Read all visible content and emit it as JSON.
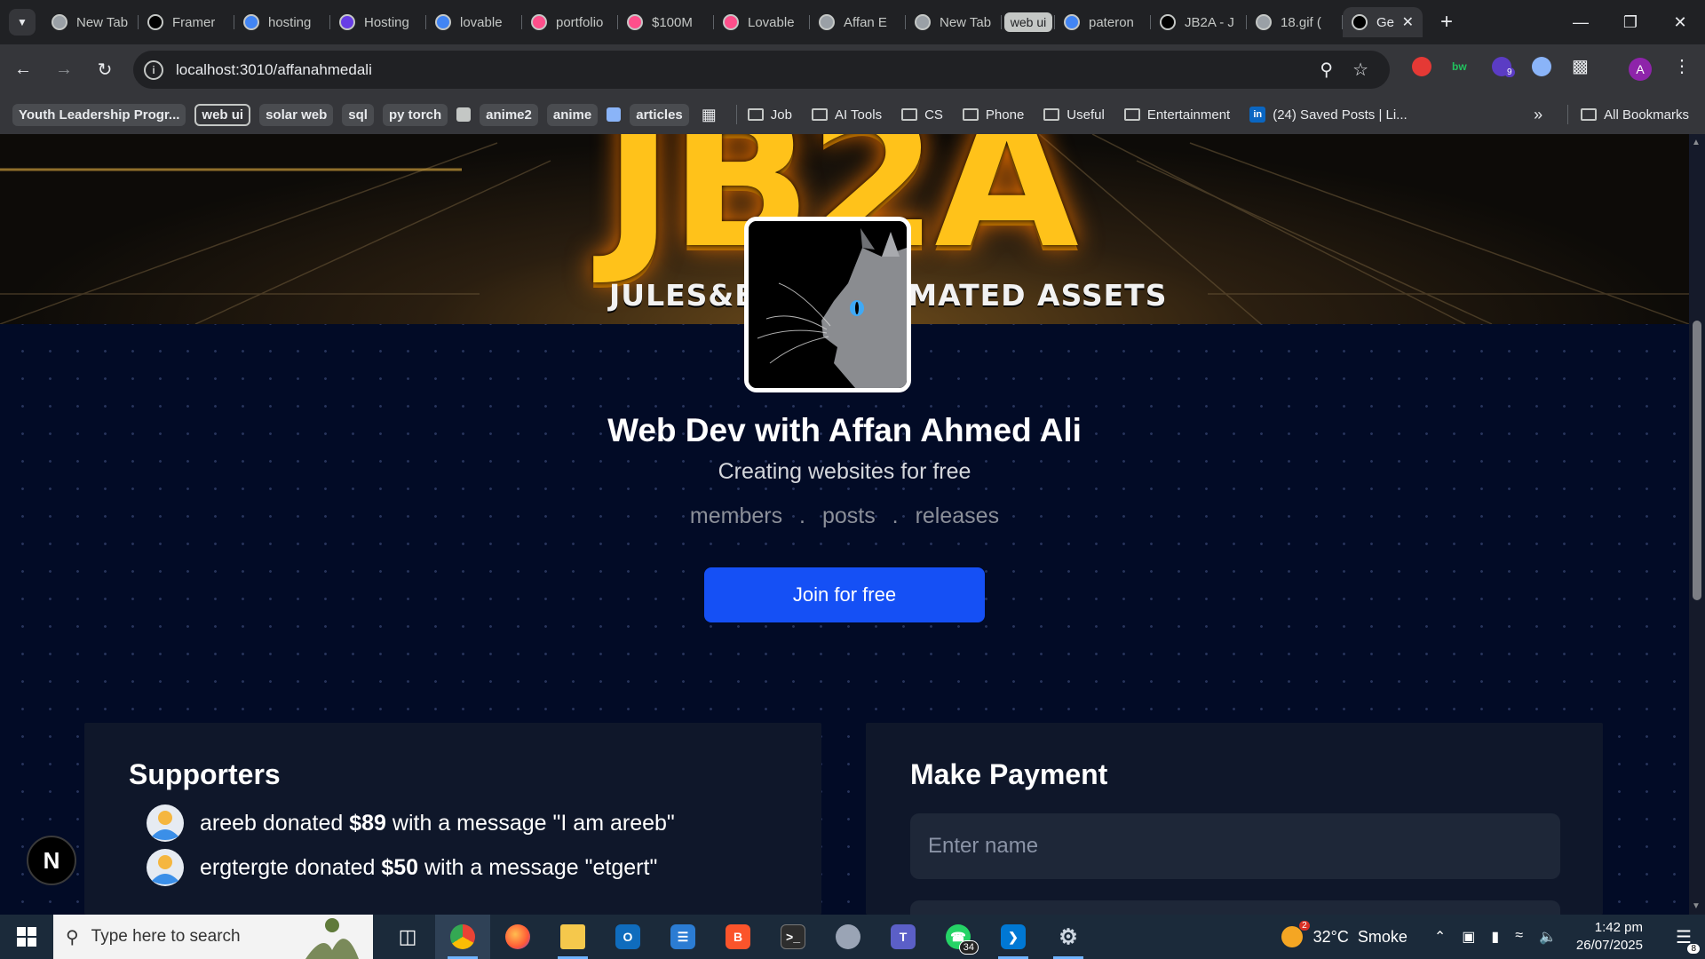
{
  "browser": {
    "tabs": [
      {
        "label": "New Tab",
        "favicon": "chrome-icon",
        "color": "#9aa0a6"
      },
      {
        "label": "Framer",
        "favicon": "framer-icon",
        "color": "#000000"
      },
      {
        "label": "hosting",
        "favicon": "google-icon",
        "color": "#4285f4"
      },
      {
        "label": "Hosting",
        "favicon": "hostinger-icon",
        "color": "#673de6"
      },
      {
        "label": "lovable",
        "favicon": "google-icon",
        "color": "#4285f4"
      },
      {
        "label": "portfolio",
        "favicon": "lovable-icon",
        "color": "#ff4f8b"
      },
      {
        "label": "$100M",
        "favicon": "lovable-icon",
        "color": "#ff4f8b"
      },
      {
        "label": "Lovable",
        "favicon": "lovable-icon",
        "color": "#ff4f8b"
      },
      {
        "label": "Affan E",
        "favicon": "globe-icon",
        "color": "#9aa0a6"
      },
      {
        "label": "New Tab",
        "favicon": "chrome-icon",
        "color": "#9aa0a6"
      },
      {
        "label": "web ui",
        "group": true
      },
      {
        "label": "pateron",
        "favicon": "google-icon",
        "color": "#4285f4"
      },
      {
        "label": "JB2A - J",
        "favicon": "patreon-icon",
        "color": "#000000"
      },
      {
        "label": "18.gif (",
        "favicon": "globe-icon",
        "color": "#9aa0a6"
      },
      {
        "label": "Ge",
        "favicon": "vercel-icon",
        "color": "#000000",
        "active": true
      }
    ],
    "address": "localhost:3010/affanahmedali",
    "bookmarks": {
      "chips": [
        {
          "label": "Youth Leadership Progr...",
          "style": "chip"
        },
        {
          "label": "web ui",
          "style": "outline"
        },
        {
          "label": "solar web",
          "style": "chip"
        },
        {
          "label": "sql",
          "style": "chip"
        },
        {
          "label": "py torch",
          "style": "chip"
        },
        {
          "label": "",
          "style": "square",
          "color": "#c4c7c5"
        },
        {
          "label": "anime2",
          "style": "chip"
        },
        {
          "label": "anime",
          "style": "chip"
        },
        {
          "label": "",
          "style": "square",
          "color": "#8ab4f8"
        },
        {
          "label": "articles",
          "style": "chip"
        }
      ],
      "folders": [
        "Job",
        "AI Tools",
        "CS",
        "Phone",
        "Useful",
        "Entertainment"
      ],
      "linkedin": "(24) Saved Posts | Li...",
      "all_bookmarks": "All Bookmarks"
    },
    "extension_badge": "9",
    "profile_initial": "A"
  },
  "page": {
    "banner": {
      "title": "JB2A",
      "subtitle": "JULES&BEN'S ANIMATED ASSETS"
    },
    "creator_name": "Web Dev with Affan Ahmed Ali",
    "tagline": "Creating websites for free",
    "stats": {
      "members": "members",
      "sep1": ".",
      "posts": "posts",
      "sep2": ".",
      "releases": "releases"
    },
    "join_button": "Join for free",
    "supporters": {
      "heading": "Supporters",
      "items": [
        {
          "name": "areeb",
          "verb": " donated ",
          "amount": "$89",
          "pre": " with a message ",
          "message": "\"I am areeb\""
        },
        {
          "name": "ergtergte",
          "verb": " donated ",
          "amount": "$50",
          "pre": " with a message ",
          "message": "\"etgert\""
        }
      ]
    },
    "payment": {
      "heading": "Make Payment",
      "name_placeholder": "Enter name"
    },
    "next_badge": "N"
  },
  "taskbar": {
    "search_placeholder": "Type here to search",
    "whatsapp_badge": "34",
    "weather_temp": "32°C",
    "weather_desc": "Smoke",
    "weather_badge": "2",
    "time": "1:42 pm",
    "date": "26/07/2025",
    "notifications": "8"
  },
  "colors": {
    "accent_button": "#1550f5",
    "page_background": "#020b26",
    "card_background": "#0f172a"
  }
}
